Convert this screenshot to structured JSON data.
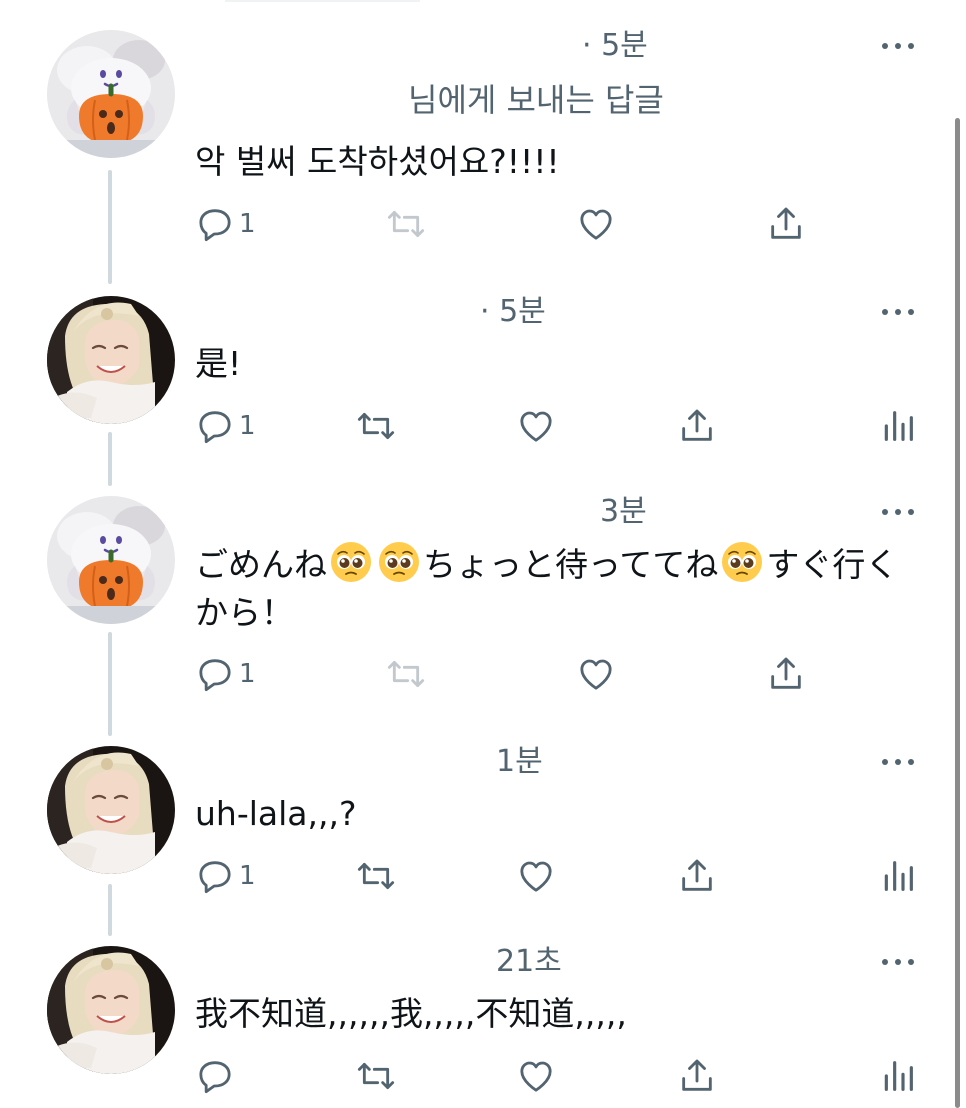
{
  "icons": {
    "reply": "speech-bubble-icon",
    "retweet": "retweet-icon",
    "like": "heart-icon",
    "share": "share-upload-icon",
    "analytics": "analytics-bars-icon",
    "more": "more-dots-icon",
    "emoji": "pleading-face-emoji"
  },
  "colors": {
    "text": "#0f1419",
    "secondary": "#536471",
    "thread_line": "#cfd9de",
    "pumpkin": "#f07a2b"
  },
  "tweets": [
    {
      "avatar": "ghost-pumpkin-avatar",
      "time": "· 5분",
      "reply_to": "님에게 보내는 답글",
      "text": "악 벌써 도착하셨어요?!!!!",
      "reply_count": "1"
    },
    {
      "avatar": "blonde-person-avatar",
      "time": "· 5분",
      "text": "是!",
      "reply_count": "1"
    },
    {
      "avatar": "ghost-pumpkin-avatar",
      "time": "3분",
      "text_parts": [
        "ごめんね",
        "",
        "ちょっと待っててね",
        "すぐ行くから！"
      ],
      "reply_count": "1"
    },
    {
      "avatar": "blonde-person-avatar",
      "time": "1분",
      "text": "uh-lala,,,?",
      "reply_count": "1"
    },
    {
      "avatar": "blonde-person-avatar",
      "time": "21초",
      "text": "我不知道,,,,,,我,,,,,不知道,,,,,",
      "reply_count": ""
    }
  ]
}
